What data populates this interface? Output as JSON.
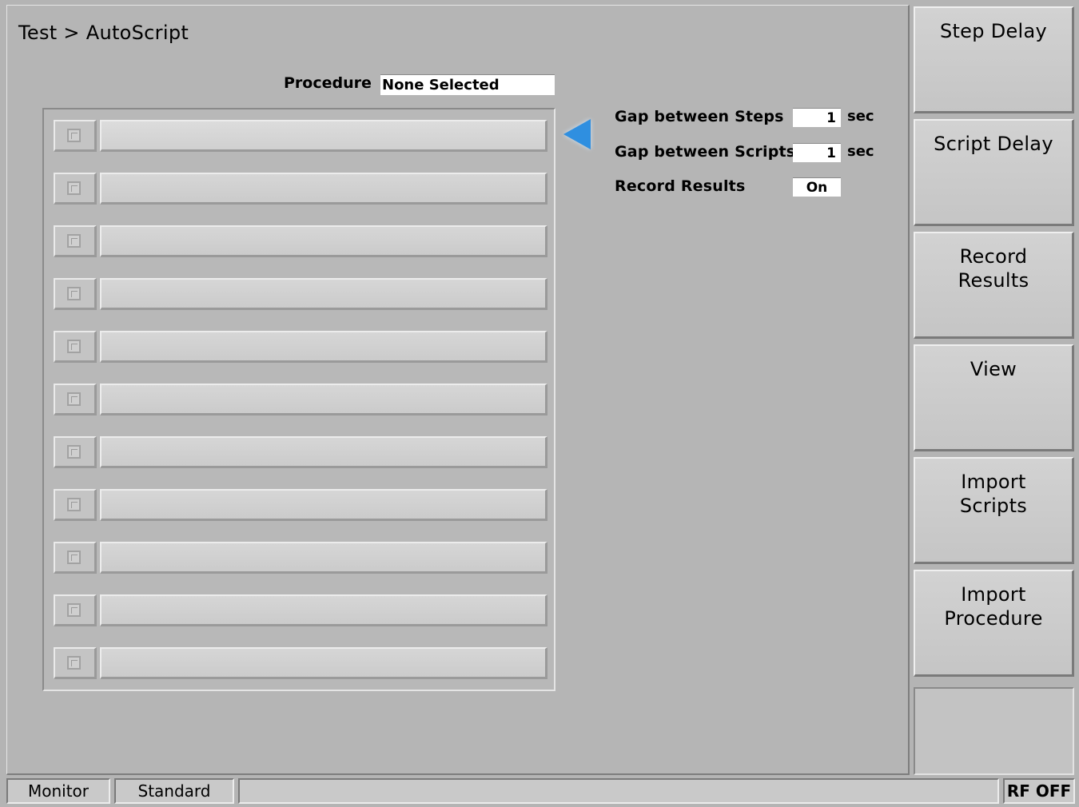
{
  "header": {
    "breadcrumb": "Test > AutoScript"
  },
  "procedure": {
    "label": "Procedure",
    "value": "None Selected"
  },
  "script_list": {
    "rows": [
      "",
      "",
      "",
      "",
      "",
      "",
      "",
      "",
      "",
      "",
      ""
    ]
  },
  "settings": {
    "gap_steps": {
      "label": "Gap between Steps",
      "value": "1",
      "unit": "sec"
    },
    "gap_scripts": {
      "label": "Gap between Scripts",
      "value": "1",
      "unit": "sec"
    },
    "record_results": {
      "label": "Record Results",
      "value": "On"
    }
  },
  "softkeys": [
    {
      "line1": "Step Delay",
      "line2": ""
    },
    {
      "line1": "Script Delay",
      "line2": ""
    },
    {
      "line1": "Record",
      "line2": "Results"
    },
    {
      "line1": "View",
      "line2": ""
    },
    {
      "line1": "Import",
      "line2": "Scripts"
    },
    {
      "line1": "Import",
      "line2": "Procedure"
    }
  ],
  "statusbar": {
    "mode": "Monitor",
    "standard": "Standard",
    "message": "",
    "rf": "RF OFF"
  },
  "colors": {
    "background": "#b4b4b4",
    "selection_arrow": "#2f8fe0",
    "field_bg": "#ffffff"
  },
  "icons": {
    "selection_arrow": "left-pointing-triangle-icon",
    "row_checkbox": "checkbox-icon"
  }
}
